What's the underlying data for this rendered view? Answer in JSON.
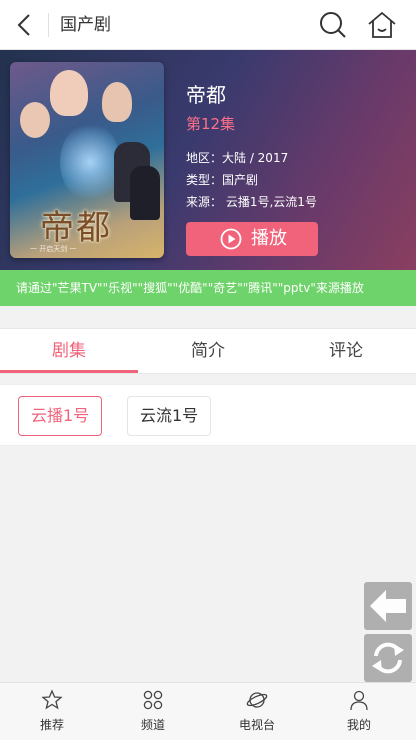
{
  "header": {
    "title": "国产剧"
  },
  "hero": {
    "poster_title": "帝都",
    "poster_subtitle": "一 开启天剑 一",
    "name": "帝都",
    "episode": "第12集",
    "region": "地区：大陆 / 2017",
    "type": "类型：国产剧",
    "source": "来源： 云播1号,云流1号",
    "play_label": "播放"
  },
  "notice": "请通过\"芒果TV\"\"乐视\"\"搜狐\"\"优酷\"\"奇艺\"\"腾讯\"\"pptv\"来源播放",
  "tabs": [
    {
      "label": "剧集",
      "active": true
    },
    {
      "label": "简介",
      "active": false
    },
    {
      "label": "评论",
      "active": false
    }
  ],
  "sources": [
    {
      "label": "云播1号",
      "active": true
    },
    {
      "label": "云流1号",
      "active": false
    }
  ],
  "bottom_nav": [
    {
      "label": "推荐",
      "icon": "star-icon"
    },
    {
      "label": "频道",
      "icon": "grid-icon"
    },
    {
      "label": "电视台",
      "icon": "planet-icon"
    },
    {
      "label": "我的",
      "icon": "user-icon"
    }
  ],
  "colors": {
    "accent": "#f0637a",
    "notice_bg": "#6ed36a"
  }
}
